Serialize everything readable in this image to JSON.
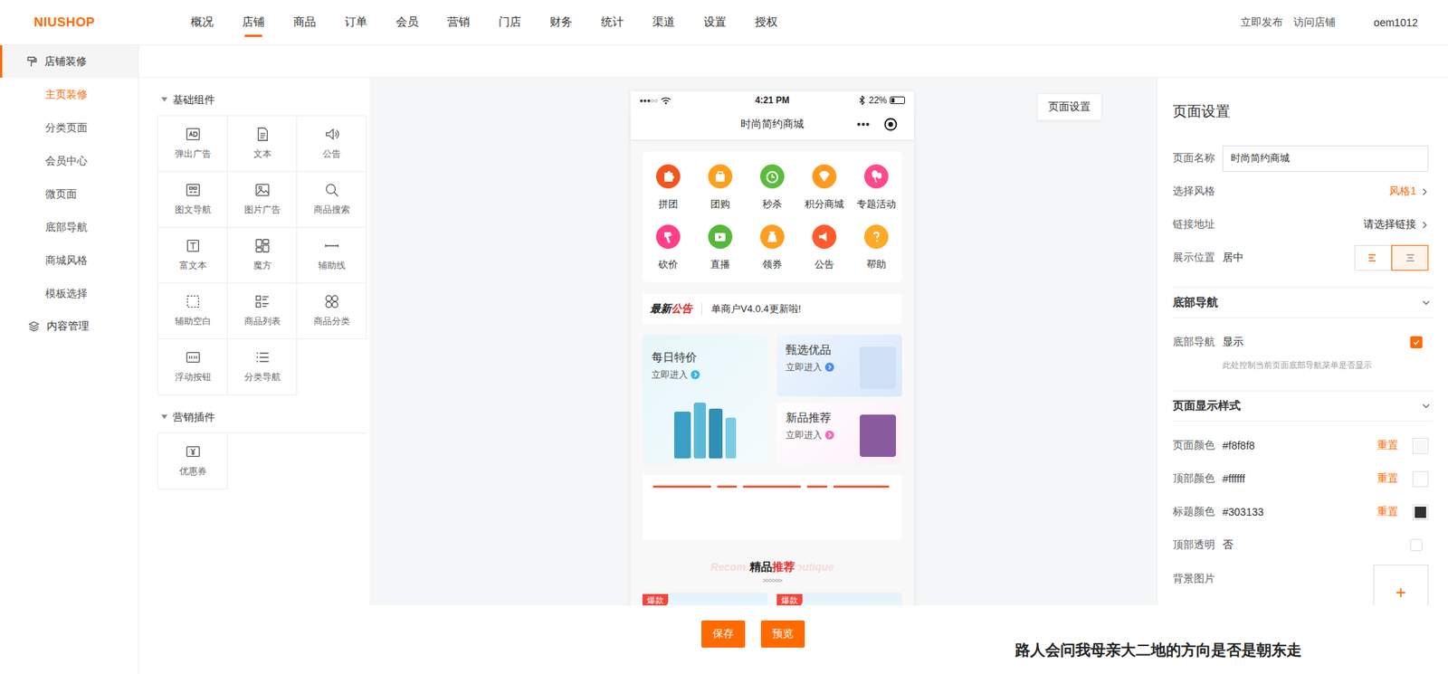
{
  "header": {
    "logo": "NIUSHOP",
    "nav": [
      {
        "label": "概况",
        "selected": false
      },
      {
        "label": "店铺",
        "selected": true
      },
      {
        "label": "商品",
        "selected": false
      },
      {
        "label": "订单",
        "selected": false
      },
      {
        "label": "会员",
        "selected": false
      },
      {
        "label": "营销",
        "selected": false
      },
      {
        "label": "门店",
        "selected": false
      },
      {
        "label": "财务",
        "selected": false
      },
      {
        "label": "统计",
        "selected": false
      },
      {
        "label": "渠道",
        "selected": false
      },
      {
        "label": "设置",
        "selected": false
      },
      {
        "label": "授权",
        "selected": false
      }
    ],
    "actions": [
      "立即发布",
      "访问店铺"
    ],
    "user": "oem1012"
  },
  "sidebar": {
    "groups": [
      {
        "label": "店铺装修",
        "selected": true,
        "items": [
          {
            "label": "主页装修",
            "selected": true
          },
          {
            "label": "分类页面",
            "selected": false
          },
          {
            "label": "会员中心",
            "selected": false
          },
          {
            "label": "微页面",
            "selected": false
          },
          {
            "label": "底部导航",
            "selected": false
          },
          {
            "label": "商城风格",
            "selected": false
          },
          {
            "label": "模板选择",
            "selected": false
          }
        ]
      },
      {
        "label": "内容管理",
        "selected": false,
        "items": []
      }
    ]
  },
  "components": {
    "sections": [
      {
        "title": "基础组件",
        "expanded": true,
        "items": [
          "弹出广告",
          "文本",
          "公告",
          "图文导航",
          "图片广告",
          "商品搜索",
          "富文本",
          "魔方",
          "辅助线",
          "辅助空白",
          "商品列表",
          "商品分类",
          "浮动按钮",
          "分类导航"
        ]
      },
      {
        "title": "营销插件",
        "expanded": true,
        "items": [
          "优惠券"
        ]
      }
    ]
  },
  "preview": {
    "status_bar": {
      "signal": "●●●○○",
      "time": "4:21 PM",
      "battery": "22%",
      "battery_level": 0.22
    },
    "title": "时尚简约商城",
    "capsule": "•••",
    "nav_icons": [
      {
        "label": "拼团",
        "color": "#f5541c"
      },
      {
        "label": "团购",
        "color": "#ff9f1a"
      },
      {
        "label": "秒杀",
        "color": "#5dbb3c"
      },
      {
        "label": "积分商城",
        "color": "#ff9a1f"
      },
      {
        "label": "专题活动",
        "color": "#ff4a8e"
      },
      {
        "label": "砍价",
        "color": "#ff3f8a"
      },
      {
        "label": "直播",
        "color": "#55b83a"
      },
      {
        "label": "领券",
        "color": "#ff9e1e"
      },
      {
        "label": "公告",
        "color": "#ff5a2c"
      },
      {
        "label": "帮助",
        "color": "#ffa928"
      }
    ],
    "notice": {
      "badge_a": "最新",
      "badge_b": "公告",
      "text": "单商户V4.0.4更新啦!"
    },
    "cube": [
      {
        "title": "每日特价",
        "link": "立即进入",
        "color": "#3cb4e6"
      },
      {
        "title": "甄选优品",
        "link": "立即进入",
        "color": "#4b8bf5"
      },
      {
        "title": "新品推荐",
        "link": "立即进入",
        "color": "#f06fb3"
      }
    ],
    "recommend": {
      "title_a": "精品",
      "title_b": "推荐",
      "watermark": "Recommended boutique",
      "arrows": ">>>>>>"
    },
    "products": [
      {
        "badge": "爆款"
      },
      {
        "badge": "爆款"
      }
    ]
  },
  "page_settings_button": "页面设置",
  "settings": {
    "title": "页面设置",
    "fields": [
      {
        "kind": "input",
        "label": "页面名称",
        "value": "时尚简约商城"
      },
      {
        "kind": "select",
        "label": "选择风格",
        "value": "风格1",
        "color": "#ff6a00"
      },
      {
        "kind": "select",
        "label": "链接地址",
        "value": "请选择链接",
        "color": "#303133"
      },
      {
        "kind": "align",
        "label": "展示位置",
        "value": "居中",
        "options": [
          {
            "kind": "left",
            "selected": false
          },
          {
            "kind": "center",
            "selected": true
          }
        ]
      }
    ],
    "sections": [
      {
        "title": "底部导航",
        "expanded": true,
        "rows": [
          {
            "kind": "checkbox",
            "label": "底部导航",
            "value": "显示",
            "checked": true,
            "hint": "此处控制当前页面底部导航菜单是否显示"
          }
        ]
      },
      {
        "title": "页面显示样式",
        "expanded": true,
        "rows": [
          {
            "kind": "color",
            "label": "页面颜色",
            "value": "#f8f8f8",
            "reset": "重置",
            "color": "#f8f8f8"
          },
          {
            "kind": "color",
            "label": "顶部颜色",
            "value": "#ffffff",
            "reset": "重置",
            "color": "#ffffff"
          },
          {
            "kind": "color",
            "label": "标题颜色",
            "value": "#303133",
            "reset": "重置",
            "color": "#303133"
          },
          {
            "kind": "checkbox",
            "label": "顶部透明",
            "value": "否",
            "checked": false
          },
          {
            "kind": "upload",
            "label": "背景图片",
            "icon": "+"
          }
        ]
      }
    ]
  },
  "footer": {
    "buttons": [
      "保存",
      "预览"
    ]
  },
  "subtitle": "路人会问我母亲大二地的方向是否是朝东走"
}
